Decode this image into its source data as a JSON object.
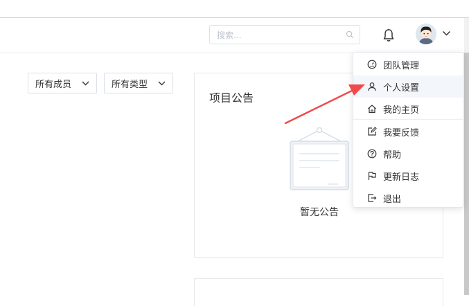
{
  "header": {
    "search_placeholder": "搜索...",
    "icons": [
      "search-icon",
      "bell-icon",
      "chevron-down-icon"
    ]
  },
  "filters": {
    "members": "所有成员",
    "types": "所有类型"
  },
  "announcement_card": {
    "title": "项目公告",
    "empty_text": "暂无公告"
  },
  "user_menu": {
    "items": [
      {
        "label": "团队管理",
        "icon": "dashboard-icon"
      },
      {
        "label": "个人设置",
        "icon": "user-icon",
        "highlighted": true
      },
      {
        "label": "我的主页",
        "icon": "home-icon"
      },
      {
        "label": "我要反馈",
        "icon": "edit-icon"
      },
      {
        "label": "帮助",
        "icon": "help-icon"
      },
      {
        "label": "更新日志",
        "icon": "flag-icon"
      },
      {
        "label": "退出",
        "icon": "logout-icon"
      }
    ]
  },
  "colors": {
    "annotation_arrow": "#f04a4a",
    "menu_highlight": "#f3f6fa",
    "border": "#dcdfe6"
  }
}
